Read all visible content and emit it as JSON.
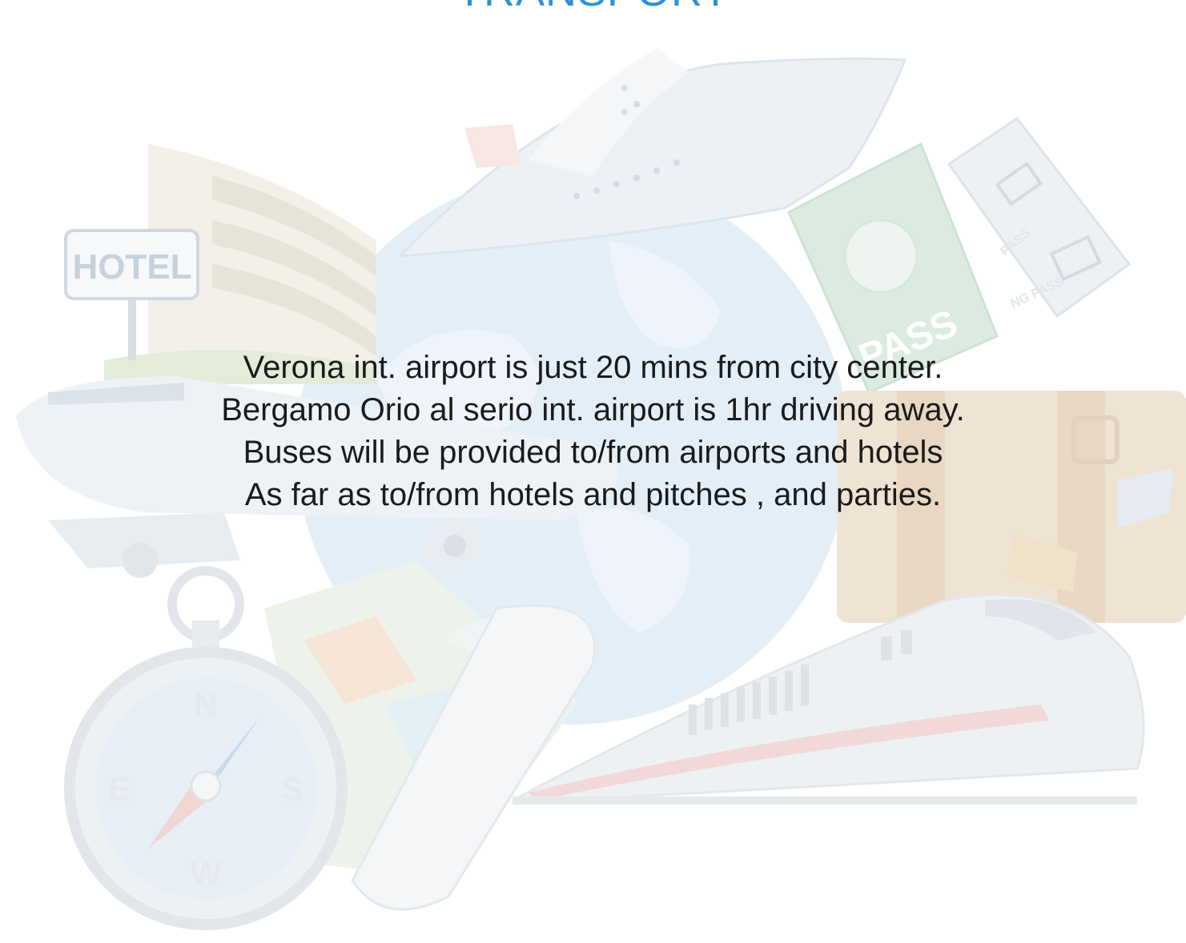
{
  "slide": {
    "title": "TRANSPORT",
    "lines": [
      "Verona int. airport is just 20 mins from city center.",
      "Bergamo Orio al serio int. airport is 1hr driving away.",
      "Buses will be provided to/from airports and hotels",
      "As far as to/from hotels and pitches , and parties."
    ]
  },
  "illustration": {
    "hotel_sign": "HOTEL",
    "passport_label": "PASS",
    "ticket_label_1": "PASS",
    "ticket_label_2": "NG PASS",
    "compass_north": "N",
    "compass_south": "S",
    "compass_east": "E",
    "compass_west": "W"
  },
  "colors": {
    "title": "#2f8fd6",
    "text": "#1b1b1b"
  }
}
